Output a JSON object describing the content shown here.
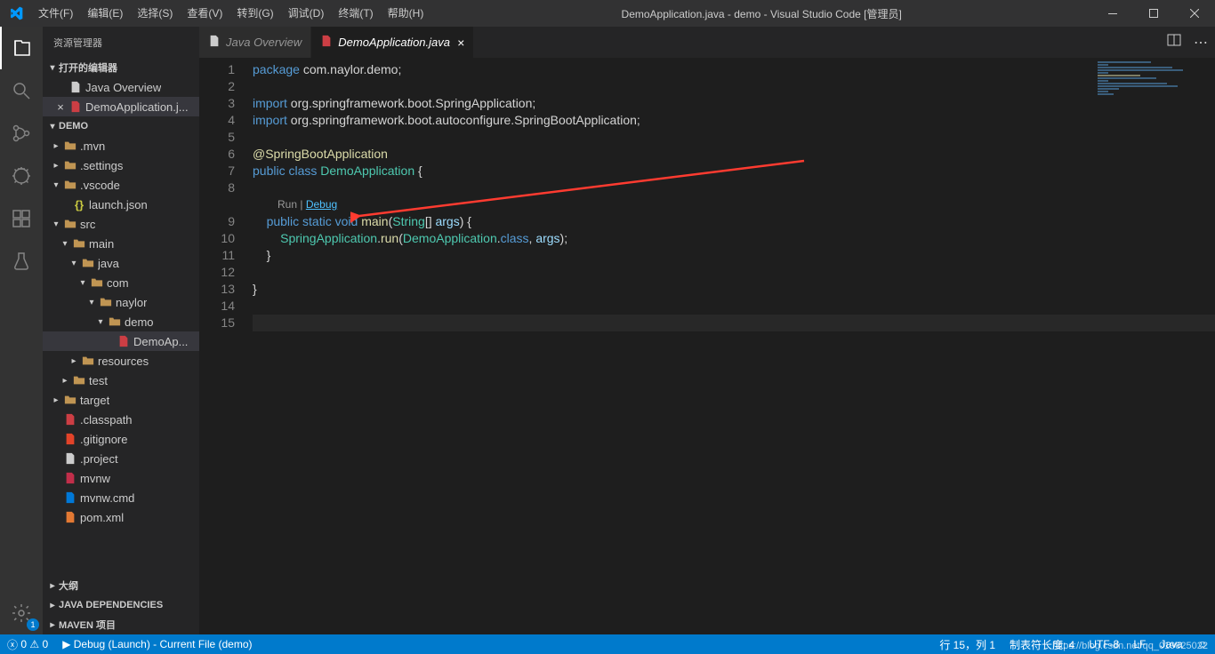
{
  "titlebar": {
    "menus": [
      "文件(F)",
      "编辑(E)",
      "选择(S)",
      "查看(V)",
      "转到(G)",
      "调试(D)",
      "终端(T)",
      "帮助(H)"
    ],
    "title": "DemoApplication.java - demo - Visual Studio Code [管理员]"
  },
  "sidebar": {
    "title": "资源管理器",
    "sections": {
      "open_editors": "打开的编辑器",
      "editors": [
        {
          "icon": "java-overview",
          "label": "Java Overview",
          "close": false
        },
        {
          "icon": "java",
          "label": "DemoApplication.j...",
          "close": true,
          "active": true
        }
      ],
      "project": "DEMO",
      "tree": [
        {
          "depth": 0,
          "caret": "▸",
          "icon": "folder",
          "label": ".mvn"
        },
        {
          "depth": 0,
          "caret": "▸",
          "icon": "folder",
          "label": ".settings"
        },
        {
          "depth": 0,
          "caret": "▾",
          "icon": "folder",
          "label": ".vscode"
        },
        {
          "depth": 1,
          "caret": "",
          "icon": "json",
          "label": "launch.json"
        },
        {
          "depth": 0,
          "caret": "▾",
          "icon": "folder",
          "label": "src"
        },
        {
          "depth": 1,
          "caret": "▾",
          "icon": "folder",
          "label": "main"
        },
        {
          "depth": 2,
          "caret": "▾",
          "icon": "folder",
          "label": "java"
        },
        {
          "depth": 3,
          "caret": "▾",
          "icon": "folder",
          "label": "com"
        },
        {
          "depth": 4,
          "caret": "▾",
          "icon": "folder",
          "label": "naylor"
        },
        {
          "depth": 5,
          "caret": "▾",
          "icon": "folder",
          "label": "demo"
        },
        {
          "depth": 6,
          "caret": "",
          "icon": "java",
          "label": "DemoAp...",
          "selected": true
        },
        {
          "depth": 2,
          "caret": "▸",
          "icon": "folder",
          "label": "resources"
        },
        {
          "depth": 1,
          "caret": "▸",
          "icon": "folder",
          "label": "test"
        },
        {
          "depth": 0,
          "caret": "▸",
          "icon": "folder",
          "label": "target"
        },
        {
          "depth": 0,
          "caret": "",
          "icon": "java",
          "label": ".classpath"
        },
        {
          "depth": 0,
          "caret": "",
          "icon": "git",
          "label": ".gitignore"
        },
        {
          "depth": 0,
          "caret": "",
          "icon": "file",
          "label": ".project"
        },
        {
          "depth": 0,
          "caret": "",
          "icon": "maven",
          "label": "mvnw"
        },
        {
          "depth": 0,
          "caret": "",
          "icon": "cmd",
          "label": "mvnw.cmd"
        },
        {
          "depth": 0,
          "caret": "",
          "icon": "xml",
          "label": "pom.xml"
        }
      ],
      "outline": "大纲",
      "java_deps": "JAVA DEPENDENCIES",
      "maven": "MAVEN 项目"
    }
  },
  "tabs": [
    {
      "icon": "java-overview",
      "label": "Java Overview",
      "active": false
    },
    {
      "icon": "java",
      "label": "DemoApplication.java",
      "active": true,
      "dirty": false
    }
  ],
  "codelens": {
    "run": "Run",
    "sep": " | ",
    "debug": "Debug"
  },
  "code_lines": [
    {
      "n": 1,
      "html": "<span class='kw'>package</span> <span class='pkg'>com.naylor.demo</span><span class='punct'>;</span>"
    },
    {
      "n": 2,
      "html": ""
    },
    {
      "n": 3,
      "html": "<span class='kw'>import</span> <span class='pkg'>org.springframework.boot.SpringApplication</span><span class='punct'>;</span>"
    },
    {
      "n": 4,
      "html": "<span class='kw'>import</span> <span class='pkg'>org.springframework.boot.autoconfigure.SpringBootApplication</span><span class='punct'>;</span>"
    },
    {
      "n": 5,
      "html": ""
    },
    {
      "n": 6,
      "html": "<span class='anno'>@SpringBootApplication</span>"
    },
    {
      "n": 7,
      "html": "<span class='kw'>public</span> <span class='kw'>class</span> <span class='type'>DemoApplication</span> <span class='punct'>{</span>"
    },
    {
      "n": 8,
      "html": ""
    },
    {
      "codelens": true
    },
    {
      "n": 9,
      "html": "    <span class='kw'>public</span> <span class='kw'>static</span> <span class='kw'>void</span> <span class='fn'>main</span><span class='punct'>(</span><span class='type'>String</span><span class='punct'>[]</span> <span class='var'>args</span><span class='punct'>) {</span>"
    },
    {
      "n": 10,
      "html": "        <span class='type'>SpringApplication</span><span class='punct'>.</span><span class='fn'>run</span><span class='punct'>(</span><span class='type'>DemoApplication</span><span class='punct'>.</span><span class='kw'>class</span><span class='punct'>,</span> <span class='var'>args</span><span class='punct'>);</span>"
    },
    {
      "n": 11,
      "html": "    <span class='punct'>}</span>"
    },
    {
      "n": 12,
      "html": ""
    },
    {
      "n": 13,
      "html": "<span class='punct'>}</span>"
    },
    {
      "n": 14,
      "html": ""
    },
    {
      "n": 15,
      "html": "",
      "current": true
    }
  ],
  "statusbar": {
    "errors": "0",
    "warnings": "0",
    "debug": "Debug (Launch) - Current File (demo)",
    "line_col": "行 15，列 1",
    "tab_size": "制表符长度: 4",
    "encoding": "UTF-8",
    "eol": "LF",
    "lang": "Java",
    "feedback": "☺"
  },
  "watermark": "https://blog.csdn.net/qq_019825022",
  "settings_badge": "1"
}
